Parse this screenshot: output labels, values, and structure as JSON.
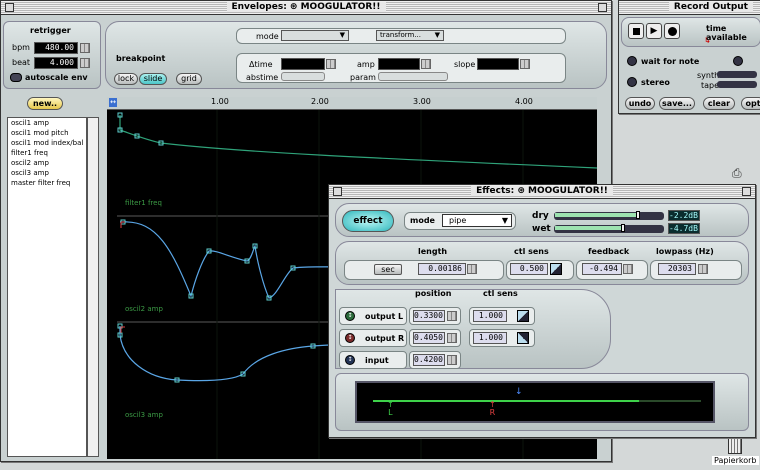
{
  "envelopes": {
    "title": "Envelopes: ⊛ MOOGULATOR!!",
    "retrigger": "retrigger",
    "bpm_label": "bpm",
    "bpm_value": "480.00",
    "beat_label": "beat",
    "beat_value": "4.000",
    "autoscale": "autoscale env",
    "new_button": "new..",
    "list": [
      "oscil1 amp",
      "oscil1 mod pitch",
      "oscil1 mod index/bal",
      "filter1 freq",
      "oscil2 amp",
      "oscil3 amp",
      "master filter freq"
    ],
    "mode_label": "mode",
    "transform_label": "transform...",
    "breakpoint_label": "breakpoint",
    "lock": "lock",
    "slide": "slide",
    "grid": "grid",
    "time_label": "Δtime",
    "abstime_label": "abstime",
    "amp_label": "amp",
    "param_label": "param",
    "slope_label": "slope",
    "ruler": [
      "1.00",
      "2.00",
      "3.00",
      "4.00"
    ],
    "lanes": [
      "filter1 freq",
      "oscil2 amp",
      "oscil3 amp"
    ]
  },
  "record": {
    "title": "Record Output",
    "time_available": "time available",
    "wait_for_note": "wait for note",
    "stereo": "stereo",
    "synth": "synth",
    "tape": "tape",
    "undo": "undo",
    "save": "save...",
    "clear": "clear",
    "opt": "opt"
  },
  "effects": {
    "title": "Effects: ⊛ MOOGULATOR!!",
    "effect_button": "effect",
    "mode_label": "mode",
    "mode_value": "pipe",
    "dry_label": "dry",
    "dry_value": "-2.2dB",
    "dry_level": 0.78,
    "wet_label": "wet",
    "wet_value": "-4.7dB",
    "wet_level": 0.64,
    "headers": {
      "length": "length",
      "ctl_sens": "ctl sens",
      "feedback": "feedback",
      "lowpass": "lowpass (Hz)"
    },
    "sec_label": "sec",
    "length_value": "0.00186",
    "ctl_sens_value": "0.500",
    "feedback_value": "-0.494",
    "lowpass_value": "20303",
    "position_header": "position",
    "ctl_sens_header": "ctl sens",
    "outputs": [
      {
        "label": "output L",
        "position": "0.3300",
        "sens": "1.000"
      },
      {
        "label": "output R",
        "position": "0.4050",
        "sens": "1.000"
      },
      {
        "label": "input",
        "position": "0.4200"
      }
    ],
    "marker_L": "L",
    "marker_R": "R"
  },
  "desktop": {
    "trash_label": "Papierkorb"
  }
}
